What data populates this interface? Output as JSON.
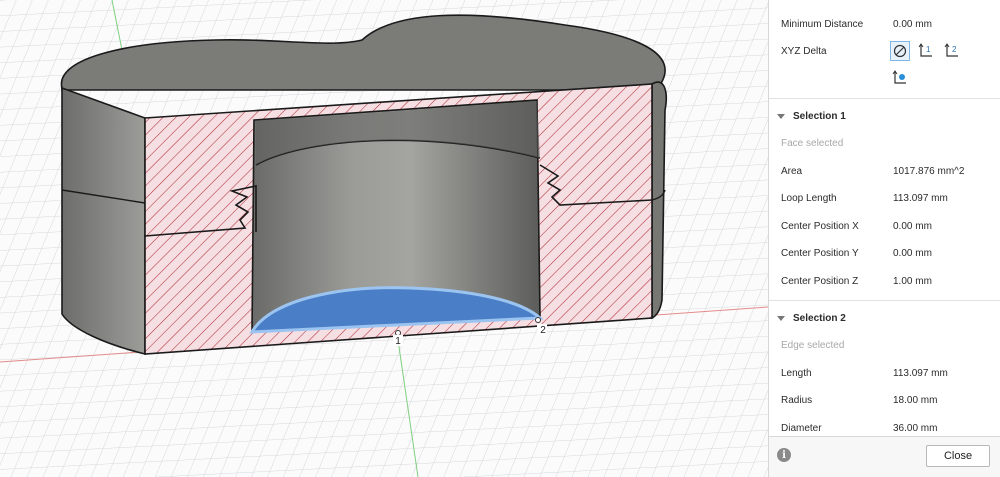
{
  "measure_panel": {
    "minimum_distance": {
      "label": "Minimum Distance",
      "value": "0.00 mm"
    },
    "xyz_delta": {
      "label": "XYZ Delta",
      "options": [
        "no-delta-icon",
        "axis-1-icon",
        "axis-2-icon",
        "axis-origin-icon"
      ],
      "selected": "no-delta-icon"
    },
    "selection1": {
      "title": "Selection 1",
      "hint": "Face selected",
      "rows": [
        {
          "label": "Area",
          "value": "1017.876 mm^2"
        },
        {
          "label": "Loop Length",
          "value": "113.097 mm"
        },
        {
          "label": "Center Position X",
          "value": "0.00 mm"
        },
        {
          "label": "Center Position Y",
          "value": "0.00 mm"
        },
        {
          "label": "Center Position Z",
          "value": "1.00 mm"
        }
      ]
    },
    "selection2": {
      "title": "Selection 2",
      "hint": "Edge selected",
      "rows": [
        {
          "label": "Length",
          "value": "113.097 mm"
        },
        {
          "label": "Radius",
          "value": "18.00 mm"
        },
        {
          "label": "Diameter",
          "value": "36.00 mm"
        }
      ]
    },
    "footer": {
      "info_icon": "info-icon",
      "close_label": "Close"
    }
  },
  "viewport": {
    "point_labels": [
      "1",
      "2"
    ],
    "colors": {
      "section_fill": "#f6dfe3",
      "hatch": "#b0303a",
      "selected_face": "#4a7ec6",
      "body_gray": "#8f8f8c",
      "grid": "#d3d5d8"
    }
  }
}
